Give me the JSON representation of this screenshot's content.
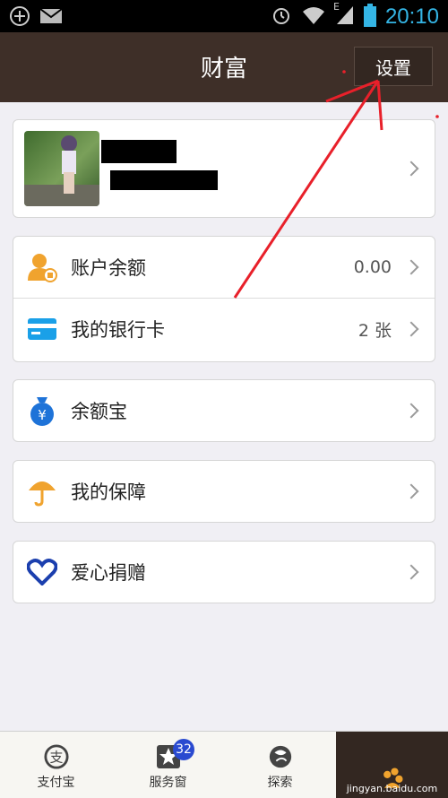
{
  "status_bar": {
    "time": "20:10",
    "network_label": "E"
  },
  "header": {
    "title": "财富",
    "settings_label": "设置"
  },
  "profile": {},
  "menu": {
    "balance": {
      "label": "账户余额",
      "value": "0.00"
    },
    "bank_card": {
      "label": "我的银行卡",
      "value": "2 张"
    },
    "yuebao": {
      "label": "余额宝"
    },
    "insurance": {
      "label": "我的保障"
    },
    "donation": {
      "label": "爱心捐赠"
    }
  },
  "tabs": [
    {
      "label": "支付宝",
      "icon": "alipay-icon"
    },
    {
      "label": "服务窗",
      "icon": "star-icon",
      "badge": "32"
    },
    {
      "label": "探索",
      "icon": "globe-icon"
    },
    {
      "label": "",
      "icon": "wealth-icon"
    }
  ],
  "watermark": "jingyan.baidu.com",
  "colors": {
    "titlebar": "#3e2f28",
    "accent_orange": "#f0a32e",
    "accent_blue": "#1e73d8",
    "badge": "#2a4ad0",
    "annotation_red": "#e8202a"
  }
}
